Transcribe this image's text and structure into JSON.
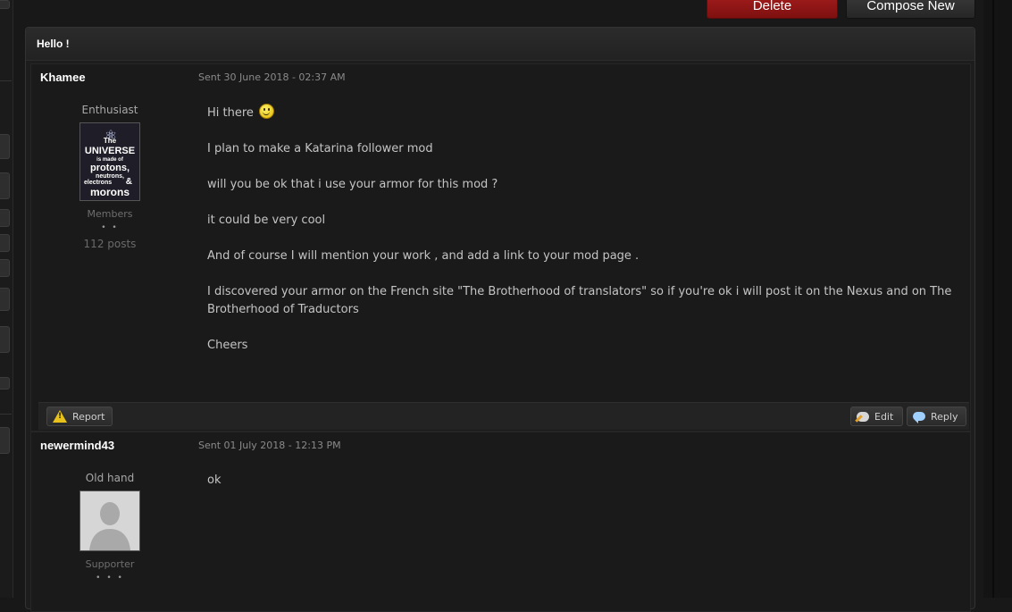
{
  "toolbar": {
    "delete_label": "Delete",
    "compose_label": "Compose New"
  },
  "conversation": {
    "title": "Hello !"
  },
  "posts": [
    {
      "author": "Khamee",
      "date": "Sent 30 June 2018 - 02:37 AM",
      "rank": "Enthusiast",
      "avatar": "universe-avatar",
      "avatar_text": [
        "The",
        "UNIVERSE",
        "is made of",
        "protons,",
        "neutrons,",
        "electrons",
        "&",
        "morons"
      ],
      "group": "Members",
      "pips": "• •",
      "post_count": "112 posts",
      "body": [
        "Hi there",
        "I plan to make a Katarina follower mod",
        "will you be ok that i use your armor for this mod ?",
        "it could be very cool",
        "And of course I will mention your work , and add a link to your mod page .",
        "I discovered your armor on the French site \"The Brotherhood of translators\" so if you're ok i will post it on the Nexus and  on The Brotherhood of Traductors",
        "Cheers"
      ]
    },
    {
      "author": "newermind43",
      "date": "Sent 01 July 2018 - 12:13 PM",
      "rank": "Old hand",
      "avatar": "default-avatar",
      "group": "Supporter",
      "pips": "• • •",
      "body": [
        "ok"
      ]
    }
  ],
  "footer": {
    "report_label": "Report",
    "edit_label": "Edit",
    "reply_label": "Reply"
  },
  "colors": {
    "delete_button": "#9b1b1b",
    "background": "#181818",
    "panel": "#1d1d1d",
    "warning_icon": "#e8c21a"
  }
}
